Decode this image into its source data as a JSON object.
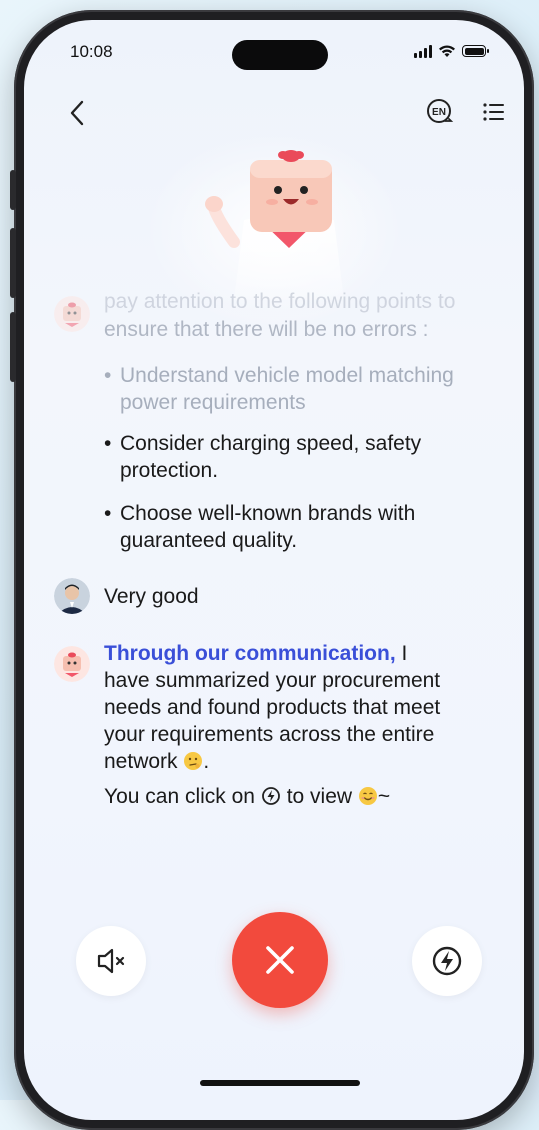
{
  "status": {
    "time": "10:08"
  },
  "nav": {
    "back_icon": "chevron-left-icon",
    "lang_icon": "en-language-icon",
    "menu_icon": "list-menu-icon",
    "lang_text": "EN"
  },
  "messages": {
    "bot1": {
      "intro_line1": "pay attention to the following points to",
      "intro_line2": "ensure that there will be no errors :",
      "bullets": [
        {
          "l1": "Understand vehicle model matching",
          "l2": "power requirements"
        },
        {
          "l1": "Consider charging speed, safety",
          "l2": "protection."
        },
        {
          "l1": "Choose well-known brands with",
          "l2": "guaranteed quality."
        }
      ]
    },
    "user": {
      "text": "Very good"
    },
    "bot2": {
      "highlight": "Through our communication,",
      "rest1": " I",
      "line2": "have summarized your procurement",
      "line3": "needs and found products that meet",
      "line4": "your requirements across the entire",
      "line5": "network",
      "line5_end": ".",
      "line6_a": "You can click on",
      "line6_b": "to view",
      "line6_end": "~"
    }
  },
  "controls": {
    "mute_icon": "speaker-mute-icon",
    "end_icon": "close-icon",
    "bolt_icon": "lightning-icon"
  },
  "colors": {
    "accent": "#3a4fd8",
    "end_call": "#f24a3d"
  }
}
